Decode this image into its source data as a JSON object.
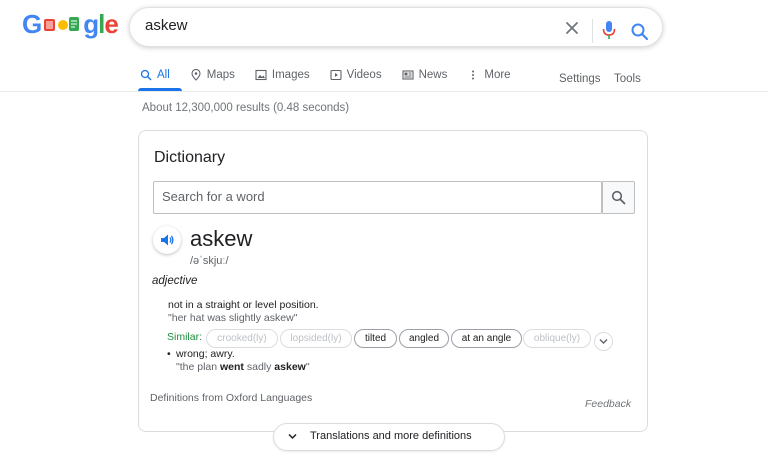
{
  "search": {
    "query": "askew"
  },
  "tabs": [
    {
      "label": "All",
      "icon": "search-icon",
      "active": true
    },
    {
      "label": "Maps",
      "icon": "map-pin-icon",
      "active": false
    },
    {
      "label": "Images",
      "icon": "image-icon",
      "active": false
    },
    {
      "label": "Videos",
      "icon": "video-icon",
      "active": false
    },
    {
      "label": "News",
      "icon": "news-icon",
      "active": false
    },
    {
      "label": "More",
      "icon": "more-vert-icon",
      "active": false
    }
  ],
  "settings_label": "Settings",
  "tools_label": "Tools",
  "results_stats": "About 12,300,000 results (0.48 seconds)",
  "dictionary": {
    "title": "Dictionary",
    "search_placeholder": "Search for a word",
    "word": "askew",
    "phonetic": "/əˈskjuː/",
    "part_of_speech": "adjective",
    "definition_1": "not in a straight or level position.",
    "example_1": "\"her hat was slightly askew\"",
    "similar_label": "Similar:",
    "similar": [
      {
        "label": "crooked(ly)",
        "enabled": false
      },
      {
        "label": "lopsided(ly)",
        "enabled": false
      },
      {
        "label": "tilted",
        "enabled": true
      },
      {
        "label": "angled",
        "enabled": true
      },
      {
        "label": "at an angle",
        "enabled": true
      },
      {
        "label": "oblique(ly)",
        "enabled": false
      }
    ],
    "bullet": "•",
    "definition_2": "wrong; awry.",
    "example_2_pre": "\"the plan ",
    "example_2_bold1": "went",
    "example_2_mid": " sadly ",
    "example_2_bold2": "askew",
    "example_2_post": "\"",
    "source": "Definitions from Oxford Languages",
    "feedback": "Feedback",
    "more_button": "Translations and more definitions"
  },
  "colors": {
    "accent": "#1a73e8",
    "similar_green": "#1e8e3e"
  }
}
